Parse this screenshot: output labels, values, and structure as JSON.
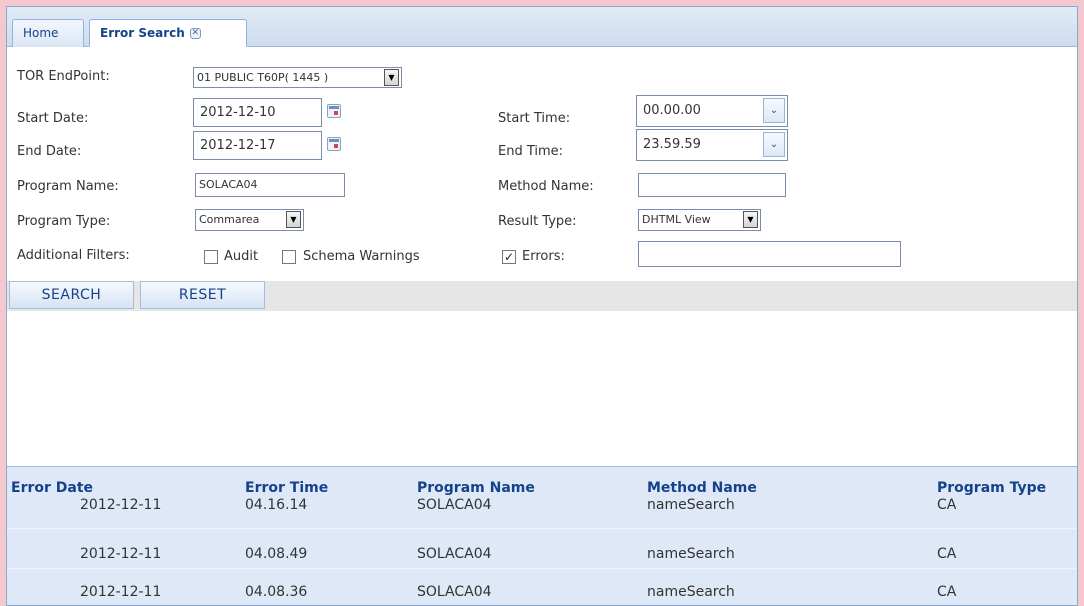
{
  "tabs": {
    "home": "Home",
    "active": "Error Search",
    "close_glyph": "✕"
  },
  "form": {
    "tor_endpoint": {
      "label": "TOR EndPoint:",
      "value": "01 PUBLIC T60P( 1445 )"
    },
    "start_date": {
      "label": "Start Date:",
      "value": "2012-12-10"
    },
    "start_time": {
      "label": "Start Time:",
      "value": "00.00.00"
    },
    "end_date": {
      "label": "End Date:",
      "value": "2012-12-17"
    },
    "end_time": {
      "label": "End Time:",
      "value": "23.59.59"
    },
    "program_name": {
      "label": "Program Name:",
      "value": "SOLACA04"
    },
    "method_name": {
      "label": "Method Name:",
      "value": ""
    },
    "program_type": {
      "label": "Program Type:",
      "value": "Commarea"
    },
    "result_type": {
      "label": "Result Type:",
      "value": "DHTML View"
    },
    "additional_filters": {
      "label": "Additional Filters:",
      "audit": {
        "label": "Audit",
        "checked": false
      },
      "schema_warnings": {
        "label": "Schema Warnings",
        "checked": false
      },
      "errors": {
        "label": "Errors:",
        "checked": true,
        "value": ""
      }
    },
    "check_glyph": "✓",
    "dropdown_glyph": "▼",
    "dropdown_glyph_blue": "⌄"
  },
  "buttons": {
    "search": "SEARCH",
    "reset": "RESET"
  },
  "grid": {
    "columns": [
      "Error Date",
      "Error Time",
      "Program Name",
      "Method Name",
      "Program Type"
    ],
    "rows": [
      [
        "2012-12-11",
        "04.16.14",
        "SOLACA04",
        "nameSearch",
        "CA"
      ],
      [
        "2012-12-11",
        "04.08.49",
        "SOLACA04",
        "nameSearch",
        "CA"
      ],
      [
        "2012-12-11",
        "04.08.36",
        "SOLACA04",
        "nameSearch",
        "CA"
      ]
    ]
  }
}
